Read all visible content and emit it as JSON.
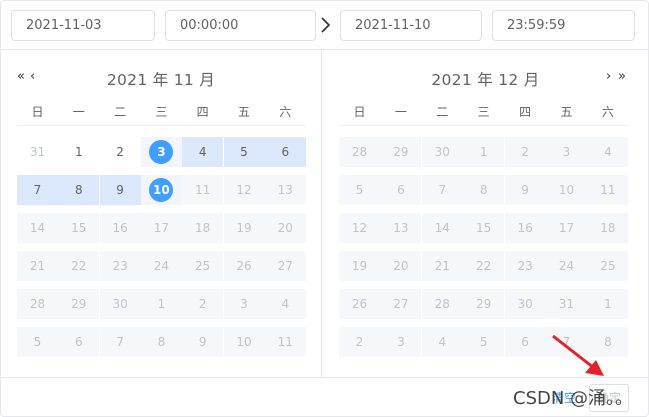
{
  "header": {
    "start_date": "2021-11-03",
    "start_time": "00:00:00",
    "end_date": "2021-11-10",
    "end_time": "23:59:59"
  },
  "left_panel": {
    "title": "2021 年 11 月",
    "nav_prev_year": "«",
    "nav_prev_month": "‹",
    "weekdays": [
      "日",
      "一",
      "二",
      "三",
      "四",
      "五",
      "六"
    ],
    "rows": [
      [
        {
          "d": "31",
          "s": "prev-next"
        },
        {
          "d": "1",
          "s": ""
        },
        {
          "d": "2",
          "s": ""
        },
        {
          "d": "3",
          "s": "active"
        },
        {
          "d": "4",
          "s": "in-range"
        },
        {
          "d": "5",
          "s": "in-range"
        },
        {
          "d": "6",
          "s": "in-range"
        }
      ],
      [
        {
          "d": "7",
          "s": "in-range"
        },
        {
          "d": "8",
          "s": "in-range"
        },
        {
          "d": "9",
          "s": "in-range"
        },
        {
          "d": "10",
          "s": "active"
        },
        {
          "d": "11",
          "s": "disabled"
        },
        {
          "d": "12",
          "s": "disabled"
        },
        {
          "d": "13",
          "s": "disabled"
        }
      ],
      [
        {
          "d": "14",
          "s": "disabled"
        },
        {
          "d": "15",
          "s": "disabled"
        },
        {
          "d": "16",
          "s": "disabled"
        },
        {
          "d": "17",
          "s": "disabled"
        },
        {
          "d": "18",
          "s": "disabled"
        },
        {
          "d": "19",
          "s": "disabled"
        },
        {
          "d": "20",
          "s": "disabled"
        }
      ],
      [
        {
          "d": "21",
          "s": "disabled"
        },
        {
          "d": "22",
          "s": "disabled"
        },
        {
          "d": "23",
          "s": "disabled"
        },
        {
          "d": "24",
          "s": "disabled"
        },
        {
          "d": "25",
          "s": "disabled"
        },
        {
          "d": "26",
          "s": "disabled"
        },
        {
          "d": "27",
          "s": "disabled"
        }
      ],
      [
        {
          "d": "28",
          "s": "disabled"
        },
        {
          "d": "29",
          "s": "disabled"
        },
        {
          "d": "30",
          "s": "disabled"
        },
        {
          "d": "1",
          "s": "disabled"
        },
        {
          "d": "2",
          "s": "disabled"
        },
        {
          "d": "3",
          "s": "disabled"
        },
        {
          "d": "4",
          "s": "disabled"
        }
      ],
      [
        {
          "d": "5",
          "s": "disabled"
        },
        {
          "d": "6",
          "s": "disabled"
        },
        {
          "d": "7",
          "s": "disabled"
        },
        {
          "d": "8",
          "s": "disabled"
        },
        {
          "d": "9",
          "s": "disabled"
        },
        {
          "d": "10",
          "s": "disabled"
        },
        {
          "d": "11",
          "s": "disabled"
        }
      ]
    ]
  },
  "right_panel": {
    "title": "2021 年 12 月",
    "nav_next_month": "›",
    "nav_next_year": "»",
    "weekdays": [
      "日",
      "一",
      "二",
      "三",
      "四",
      "五",
      "六"
    ],
    "rows": [
      [
        "28",
        "29",
        "30",
        "1",
        "2",
        "3",
        "4"
      ],
      [
        "5",
        "6",
        "7",
        "8",
        "9",
        "10",
        "11"
      ],
      [
        "12",
        "13",
        "14",
        "15",
        "16",
        "17",
        "18"
      ],
      [
        "19",
        "20",
        "21",
        "22",
        "23",
        "24",
        "25"
      ],
      [
        "26",
        "27",
        "28",
        "29",
        "30",
        "31",
        "1"
      ],
      [
        "2",
        "3",
        "4",
        "5",
        "6",
        "7",
        "8"
      ]
    ]
  },
  "footer": {
    "clear_label": "清空",
    "ok_label": "确定"
  },
  "watermark": "CSDN @涌。。",
  "colors": {
    "accent": "#409eff",
    "range_bg": "#dbe8fb",
    "disabled_bg": "#f5f7fa",
    "arrow": "#e8202a"
  }
}
